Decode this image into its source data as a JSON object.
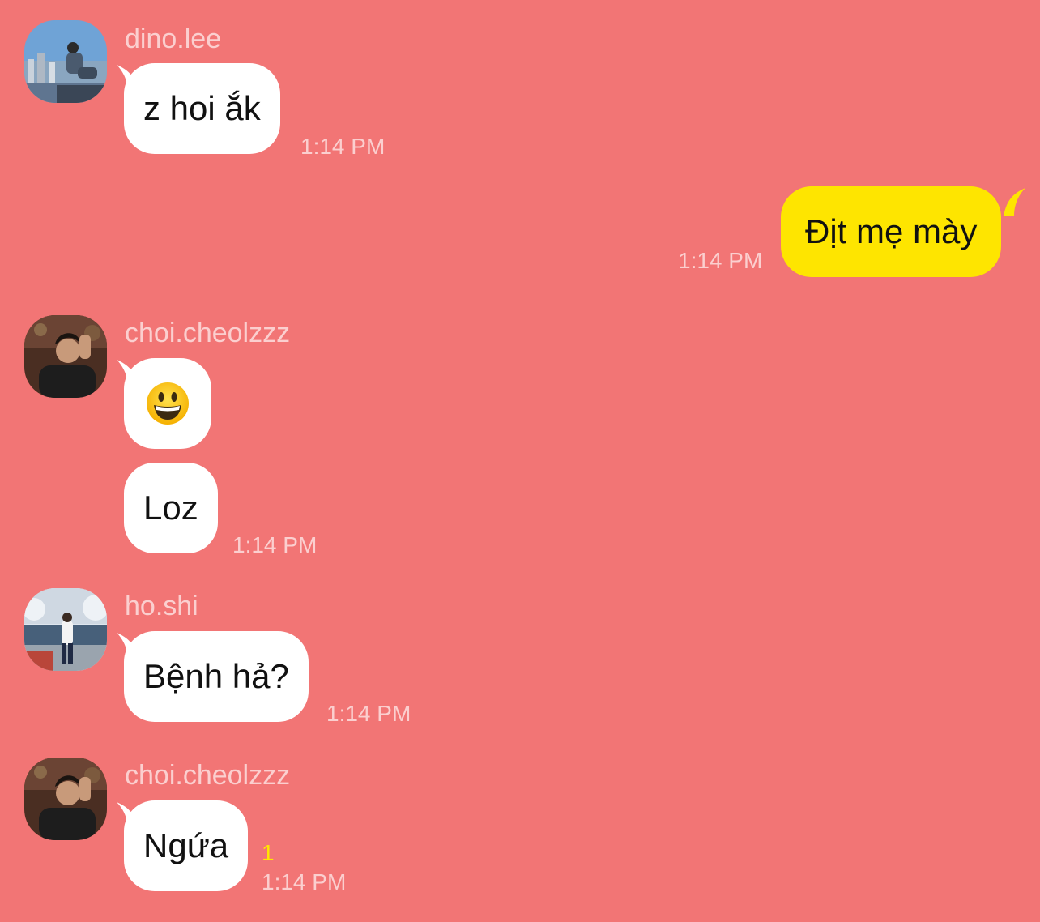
{
  "colors": {
    "background": "#f27575",
    "bubble_other": "#ffffff",
    "bubble_mine": "#fee500",
    "meta_text": "#fbcfcf",
    "unread": "#ffe600"
  },
  "messages": [
    {
      "sender": "dino.lee",
      "avatar": "city-rooftop-photo",
      "text": "z hoi ắk",
      "time": "1:14 PM"
    },
    {
      "sender": "me",
      "text": "Địt mẹ mày",
      "time": "1:14 PM"
    },
    {
      "sender": "choi.cheolzzz",
      "avatar": "portrait-photo",
      "emoji": "grinning-face-icon",
      "text": "Loz",
      "time": "1:14 PM"
    },
    {
      "sender": "ho.shi",
      "avatar": "snow-street-photo",
      "text": "Bệnh hả?",
      "time": "1:14 PM"
    },
    {
      "sender": "choi.cheolzzz",
      "avatar": "portrait-photo",
      "text": "Ngứa",
      "unread": "1",
      "time": "1:14 PM"
    }
  ]
}
